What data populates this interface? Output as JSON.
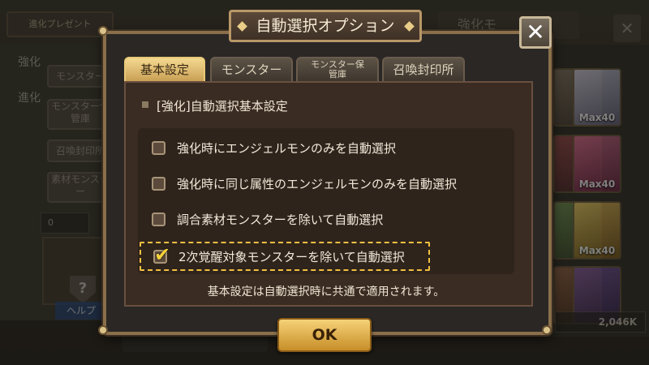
{
  "background": {
    "top_badge": "進化プレゼント",
    "side_labels": [
      "強化",
      "進化"
    ],
    "side_buttons": [
      "モンスター",
      "モンスター保管庫",
      "召喚封印所",
      "素材モンスター"
    ],
    "count_value": "0",
    "help_label": "ヘルプ",
    "right_tab": "強化モ",
    "card_levels": [
      "Max40",
      "Max40",
      "Max40"
    ],
    "bottom_value": "2,046K"
  },
  "dialog": {
    "title": "自動選択オプション",
    "close_label": "✕",
    "tabs": [
      {
        "label": "基本設定",
        "active": true
      },
      {
        "label": "モンスター",
        "active": false
      },
      {
        "label": "モンスター保管庫",
        "active": false
      },
      {
        "label": "召喚封印所",
        "active": false
      }
    ],
    "section_header": "[強化]自動選択基本設定",
    "options": [
      {
        "label": "強化時にエンジェルモンのみを自動選択",
        "checked": false
      },
      {
        "label": "強化時に同じ属性のエンジェルモンのみを自動選択",
        "checked": false
      },
      {
        "label": "調合素材モンスターを除いて自動選択",
        "checked": false
      },
      {
        "label": "2次覚醒対象モンスターを除いて自動選択",
        "checked": true
      }
    ],
    "footnote": "基本設定は自動選択時に共通で適用されます。",
    "ok_label": "OK"
  },
  "colors": {
    "accent": "#f0c040",
    "active_tab": "#e8c878",
    "ok_button": "#e0ac48"
  }
}
